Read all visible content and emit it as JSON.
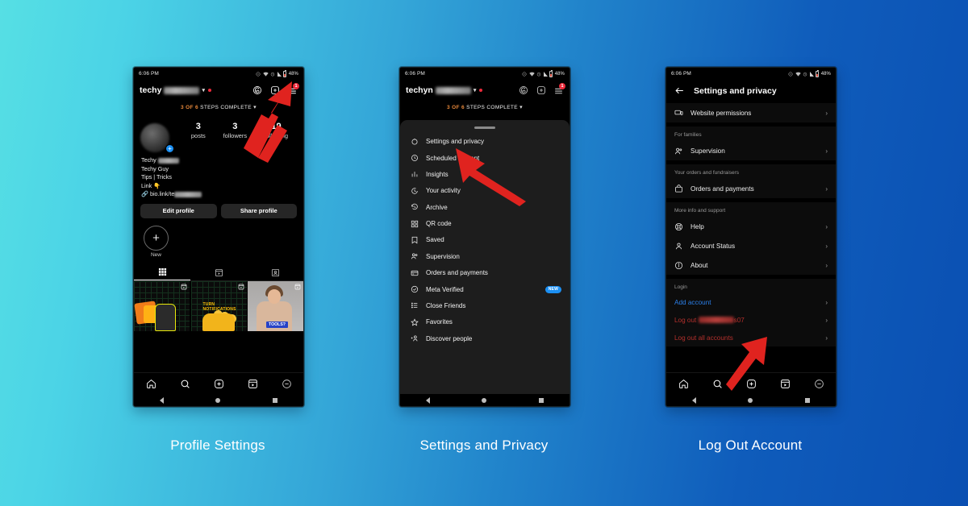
{
  "background": {
    "from": "#56dfe4",
    "mid": "#2b8fd0",
    "to": "#0a4fb2"
  },
  "captions": [
    {
      "text": "Profile Settings"
    },
    {
      "text": "Settings and Privacy"
    },
    {
      "text": "Log Out Account"
    }
  ],
  "status_bar": {
    "time": "6:06 PM",
    "battery": "48%"
  },
  "phone1": {
    "username": "techy",
    "steps": {
      "progress": "3 OF 6",
      "text": "STEPS COMPLETE"
    },
    "notification_badge": "1",
    "stats": [
      {
        "number": "3",
        "label": "posts"
      },
      {
        "number": "3",
        "label": "followers"
      },
      {
        "number": "19",
        "label": "following"
      }
    ],
    "bio": {
      "line1": "Techy",
      "line2": "Techy Guy",
      "line3": "Tips | Tricks",
      "line4": "Link",
      "link": "bio.link/te"
    },
    "buttons": {
      "edit": "Edit profile",
      "share": "Share profile"
    },
    "new_story_label": "New",
    "tabs": [
      "grid-icon",
      "reels-icon",
      "tagged-icon"
    ],
    "bottom_nav": [
      "home-icon",
      "search-icon",
      "create-icon",
      "reels-icon",
      "profile-icon"
    ]
  },
  "phone2": {
    "username": "techyn",
    "steps": {
      "progress": "3 OF 6",
      "text": "STEPS COMPLETE"
    },
    "notification_badge": "1",
    "menu": [
      {
        "label": "Settings and privacy",
        "icon": "gear-icon"
      },
      {
        "label": "Scheduled content",
        "icon": "clock-icon"
      },
      {
        "label": "Insights",
        "icon": "insights-icon"
      },
      {
        "label": "Your activity",
        "icon": "activity-icon"
      },
      {
        "label": "Archive",
        "icon": "archive-icon"
      },
      {
        "label": "QR code",
        "icon": "qr-code-icon"
      },
      {
        "label": "Saved",
        "icon": "bookmark-icon"
      },
      {
        "label": "Supervision",
        "icon": "supervision-icon"
      },
      {
        "label": "Orders and payments",
        "icon": "card-icon"
      },
      {
        "label": "Meta Verified",
        "icon": "verified-icon",
        "badge": "NEW"
      },
      {
        "label": "Close Friends",
        "icon": "list-icon"
      },
      {
        "label": "Favorites",
        "icon": "star-icon"
      },
      {
        "label": "Discover people",
        "icon": "add-person-icon"
      }
    ]
  },
  "phone3": {
    "title": "Settings and privacy",
    "groups": [
      {
        "label": "",
        "rows": [
          {
            "label": "Website permissions",
            "icon": "browser-icon",
            "style": "normal"
          }
        ]
      },
      {
        "label": "For families",
        "rows": [
          {
            "label": "Supervision",
            "icon": "supervision-icon",
            "style": "normal"
          }
        ]
      },
      {
        "label": "Your orders and fundraisers",
        "rows": [
          {
            "label": "Orders and payments",
            "icon": "bag-icon",
            "style": "normal"
          }
        ]
      },
      {
        "label": "More info and support",
        "rows": [
          {
            "label": "Help",
            "icon": "help-icon",
            "style": "normal"
          },
          {
            "label": "Account Status",
            "icon": "person-icon",
            "style": "normal"
          },
          {
            "label": "About",
            "icon": "info-icon",
            "style": "normal"
          }
        ]
      },
      {
        "label": "Login",
        "rows": [
          {
            "label": "Add account",
            "icon": "",
            "style": "link"
          },
          {
            "label": "Log out",
            "suffix": "s07",
            "icon": "",
            "style": "danger-blur"
          },
          {
            "label": "Log out all accounts",
            "icon": "",
            "style": "danger"
          }
        ]
      }
    ],
    "bottom_nav": [
      "home-icon",
      "search-icon",
      "create-icon",
      "reels-icon",
      "profile-icon"
    ]
  },
  "annotations": [
    {
      "name": "arrow-to-menu-icon",
      "color": "#e0231f"
    },
    {
      "name": "arrow-to-settings-and-privacy",
      "color": "#e0231f"
    },
    {
      "name": "arrow-to-log-out",
      "color": "#e0231f"
    }
  ]
}
